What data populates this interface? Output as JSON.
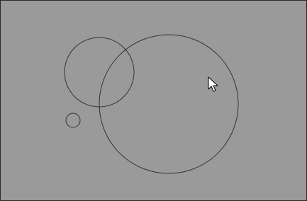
{
  "canvas": {
    "background_color": "#9a9a9a",
    "stroke_color": "#333333"
  },
  "shapes": [
    {
      "kind": "circle",
      "name": "small-left-circle"
    },
    {
      "kind": "circle",
      "name": "tiny-circle"
    },
    {
      "kind": "circle",
      "name": "large-circle"
    }
  ],
  "cursor": {
    "icon": "mouse-pointer-icon"
  }
}
